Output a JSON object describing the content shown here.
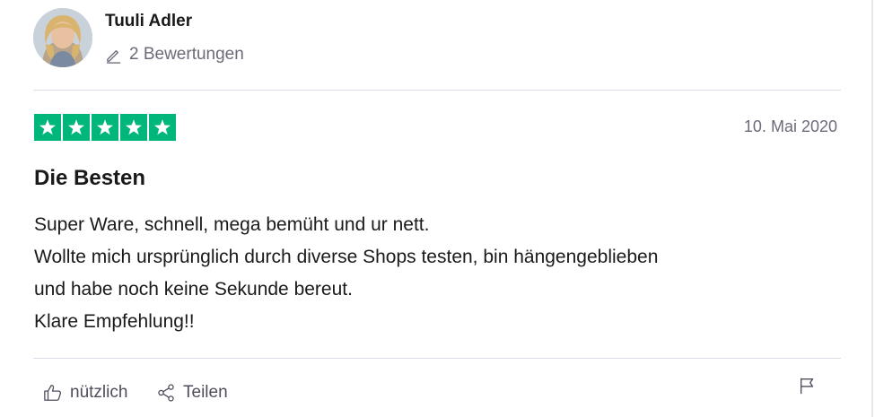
{
  "review": {
    "consumer_name": "Tuuli Adler",
    "review_count": "2 Bewertungen",
    "rating": 5,
    "date": "10. Mai 2020",
    "title": "Die Besten",
    "body_lines": [
      "Super Ware, schnell, mega bemüht und ur nett.",
      "Wollte mich ursprünglich durch diverse Shops testen, bin hängengeblieben",
      "und habe noch keine Sekunde bereut.",
      "Klare Empfehlung!!"
    ]
  },
  "actions": {
    "useful_label": "nützlich",
    "share_label": "Teilen"
  },
  "icons": {
    "review_count": "pencil-icon",
    "useful": "thumbs-up-icon",
    "share": "share-icon",
    "flag": "flag-icon"
  },
  "colors": {
    "star_green": "#00b67a",
    "muted_text": "#6b6b7a"
  }
}
